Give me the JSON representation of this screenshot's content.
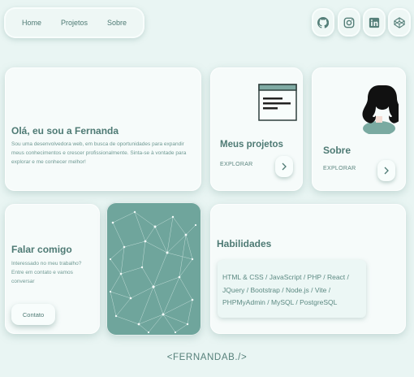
{
  "nav": {
    "items": [
      "Home",
      "Projetos",
      "Sobre"
    ]
  },
  "social": [
    "github-icon",
    "instagram-icon",
    "linkedin-icon",
    "codepen-icon"
  ],
  "intro": {
    "title": "Olá, eu sou a Fernanda",
    "text": "Sou uma desenvolvedora web, em busca de oportunidades para expandir meus conhecimentos e crescer profissionalmente. Sinta-se à vontade para explorar e me conhecer melhor!"
  },
  "projects": {
    "title": "Meus projetos",
    "explore": "EXPLORAR"
  },
  "about": {
    "title": "Sobre",
    "explore": "EXPLORAR"
  },
  "contact": {
    "title": "Falar comigo",
    "text": "Interessado no meu trabalho? Entre em contato e vamos conversar",
    "button": "Contato"
  },
  "skills": {
    "title": "Habilidades",
    "list": "HTML & CSS / JavaScript / PHP / React / JQuery / Bootstrap / Node.js / Vite / PHPMyAdmin / MySQL / PostgreSQL"
  },
  "footer": "<FERNANDAB./>",
  "colors": {
    "background": "#e9f5f3",
    "card": "#f6fbfa",
    "accent": "#6fa59c",
    "text": "#4e7a74"
  }
}
